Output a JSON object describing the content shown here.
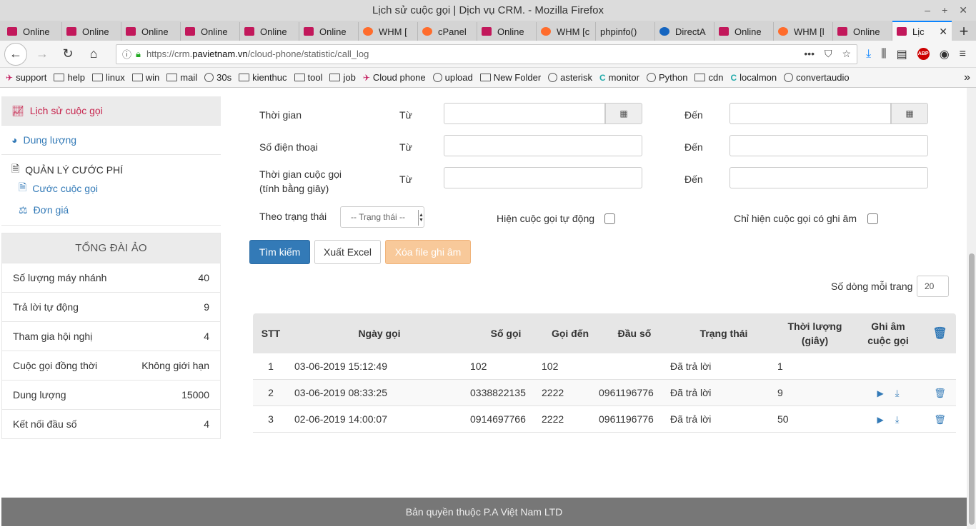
{
  "window": {
    "title": "Lịch sử cuộc gọi | Dịch vụ CRM. - Mozilla Firefox"
  },
  "tabs": [
    {
      "label": "Online",
      "icon": "online"
    },
    {
      "label": "Online",
      "icon": "online"
    },
    {
      "label": "Online",
      "icon": "online"
    },
    {
      "label": "Online",
      "icon": "online"
    },
    {
      "label": "Online",
      "icon": "online"
    },
    {
      "label": "Online",
      "icon": "online"
    },
    {
      "label": "WHM [",
      "icon": "whm"
    },
    {
      "label": "cPanel",
      "icon": "whm"
    },
    {
      "label": "Online",
      "icon": "online"
    },
    {
      "label": "WHM [c",
      "icon": "whm"
    },
    {
      "label": "phpinfo()",
      "icon": "none"
    },
    {
      "label": "DirectA",
      "icon": "da"
    },
    {
      "label": "Online",
      "icon": "online"
    },
    {
      "label": "WHM [l",
      "icon": "whm"
    },
    {
      "label": "Online",
      "icon": "online"
    },
    {
      "label": "Lịc",
      "icon": "online",
      "active": true
    }
  ],
  "url": {
    "prefix": "https://crm.",
    "host": "pavietnam.vn",
    "path": "/cloud-phone/statistic/call_log"
  },
  "bookmarks": [
    {
      "label": "support",
      "icon": "site"
    },
    {
      "label": "help",
      "icon": "folder"
    },
    {
      "label": "linux",
      "icon": "folder"
    },
    {
      "label": "win",
      "icon": "folder"
    },
    {
      "label": "mail",
      "icon": "folder"
    },
    {
      "label": "30s",
      "icon": "globe"
    },
    {
      "label": "kienthuc",
      "icon": "folder"
    },
    {
      "label": "tool",
      "icon": "folder"
    },
    {
      "label": "job",
      "icon": "folder"
    },
    {
      "label": "Cloud phone",
      "icon": "site"
    },
    {
      "label": "upload",
      "icon": "globe"
    },
    {
      "label": "New Folder",
      "icon": "folder"
    },
    {
      "label": "asterisk",
      "icon": "globe"
    },
    {
      "label": "monitor",
      "icon": "mon"
    },
    {
      "label": "Python",
      "icon": "globe"
    },
    {
      "label": "cdn",
      "icon": "folder"
    },
    {
      "label": "localmon",
      "icon": "mon"
    },
    {
      "label": "convertaudio",
      "icon": "globe"
    }
  ],
  "sidebar": {
    "history": "Lịch sử cuộc gọi",
    "capacity": "Dung lượng",
    "fee_head": "QUẢN LÝ CƯỚC PHÍ",
    "fee_call": "Cước cuộc gọi",
    "fee_price": "Đơn giá"
  },
  "virtual": {
    "title": "TỔNG ĐÀI ẢO",
    "rows": [
      {
        "label": "Số lượng máy nhánh",
        "value": "40"
      },
      {
        "label": "Trả lời tự động",
        "value": "9"
      },
      {
        "label": "Tham gia hội nghị",
        "value": "4"
      },
      {
        "label": "Cuộc gọi đồng thời",
        "value": "Không giới hạn"
      },
      {
        "label": "Dung lượng",
        "value": "15000"
      },
      {
        "label": "Kết nối đầu số",
        "value": "4"
      }
    ]
  },
  "filter": {
    "time": "Thời gian",
    "phone": "Số điện thoại",
    "duration_1": "Thời gian cuộc gọi",
    "duration_2": "(tính bằng giây)",
    "from": "Từ",
    "to": "Đến",
    "status_label": "Theo trạng thái",
    "status_value": "-- Trạng thái --",
    "auto_calls": "Hiện cuộc gọi tự động",
    "recorded_only": "Chỉ hiện cuộc gọi có ghi âm"
  },
  "buttons": {
    "search": "Tìm kiếm",
    "export": "Xuất Excel",
    "delete_records": "Xóa file ghi âm"
  },
  "pagination": {
    "label": "Số dòng mỗi trang",
    "value": "20"
  },
  "table": {
    "headers": {
      "stt": "STT",
      "date": "Ngày gọi",
      "caller": "Số gọi",
      "callee": "Gọi đến",
      "prefix": "Đầu số",
      "status": "Trạng thái",
      "duration_1": "Thời lượng",
      "duration_2": "(giây)",
      "record_1": "Ghi âm",
      "record_2": "cuộc gọi"
    },
    "rows": [
      {
        "stt": "1",
        "date": "03-06-2019 15:12:49",
        "caller": "102",
        "callee": "102",
        "prefix": "",
        "status": "Đã trả lời",
        "duration": "1",
        "has_record": false
      },
      {
        "stt": "2",
        "date": "03-06-2019 08:33:25",
        "caller": "0338822135",
        "callee": "2222",
        "prefix": "0961196776",
        "status": "Đã trả lời",
        "duration": "9",
        "has_record": true
      },
      {
        "stt": "3",
        "date": "02-06-2019 14:00:07",
        "caller": "0914697766",
        "callee": "2222",
        "prefix": "0961196776",
        "status": "Đã trả lời",
        "duration": "50",
        "has_record": true
      }
    ]
  },
  "footer": "Bản quyền thuộc P.A Việt Nam LTD"
}
